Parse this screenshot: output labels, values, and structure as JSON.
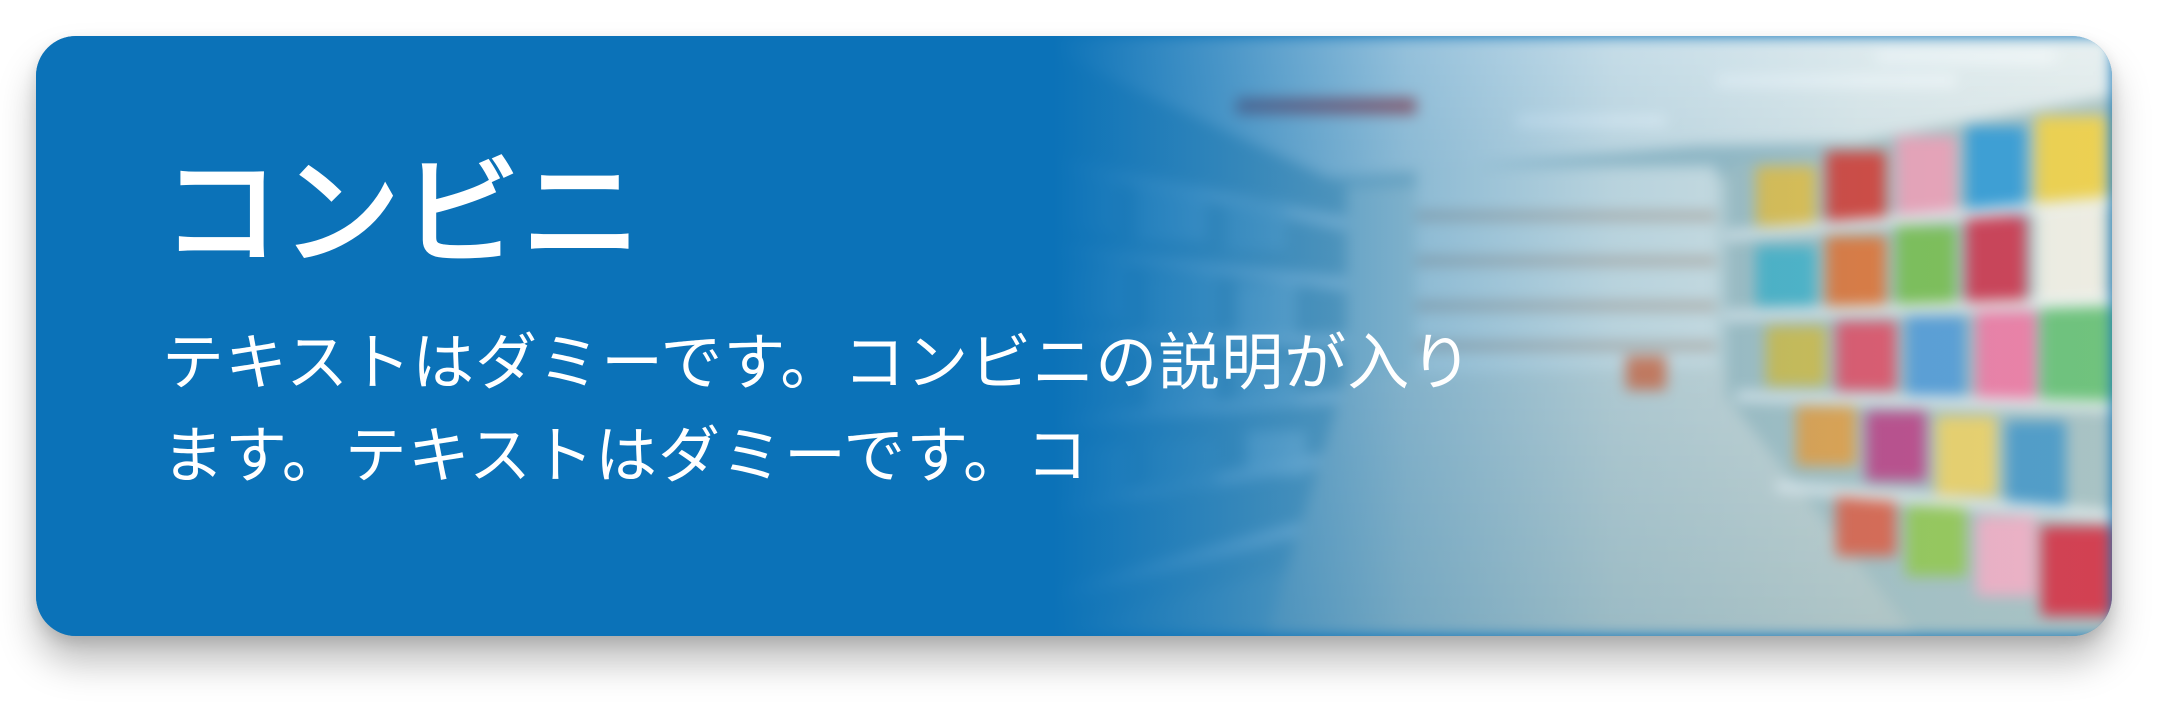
{
  "card": {
    "title": "コンビニ",
    "description": "テキストはダミーです。コンビニの説明が入ります。テキストはダミーです。コ",
    "background_image": "convenience-store-aisle",
    "accent_color": "#0a72b8",
    "text_color": "#ffffff"
  }
}
